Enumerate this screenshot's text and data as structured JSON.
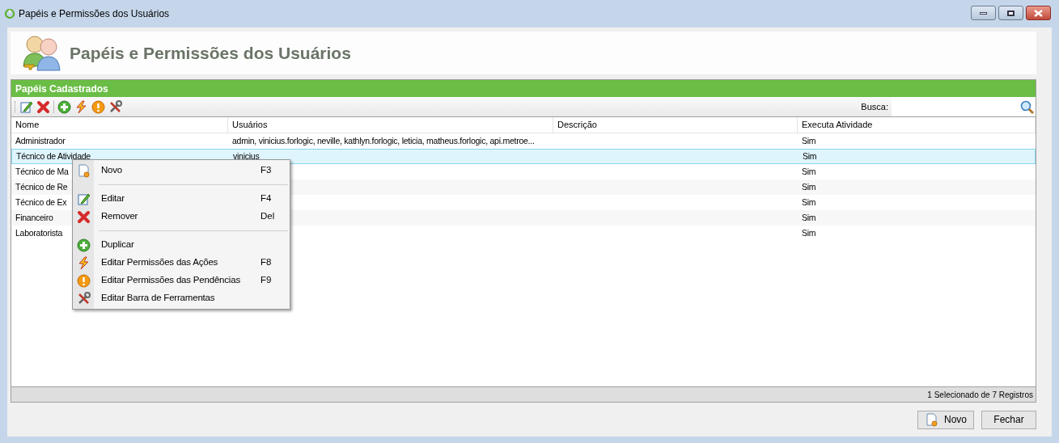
{
  "window": {
    "title": "Papéis e Permissões dos Usuários"
  },
  "header": {
    "title": "Papéis e Permissões dos Usuários"
  },
  "panel": {
    "title": "Papéis Cadastrados"
  },
  "search": {
    "label": "Busca:"
  },
  "table": {
    "columns": [
      "Nome",
      "Usuários",
      "Descrição",
      "Executa Atividade"
    ],
    "rows": [
      {
        "cells": [
          "Administrador",
          "admin, vinicius.forlogic, neville, kathlyn.forlogic, leticia, matheus.forlogic, api.metroe...",
          "",
          "Sim"
        ],
        "selected": false
      },
      {
        "cells": [
          "Técnico de Atividade",
          "vinicius",
          "",
          "Sim"
        ],
        "selected": true
      },
      {
        "cells": [
          "Técnico de Ma",
          "",
          "",
          "Sim"
        ],
        "selected": false
      },
      {
        "cells": [
          "Técnico de Re",
          "",
          "",
          "Sim"
        ],
        "selected": false
      },
      {
        "cells": [
          "Técnico de Ex",
          "",
          "",
          "Sim"
        ],
        "selected": false
      },
      {
        "cells": [
          "Financeiro",
          "",
          "",
          "Sim"
        ],
        "selected": false
      },
      {
        "cells": [
          "Laboratorista",
          "",
          "",
          "Sim"
        ],
        "selected": false
      }
    ]
  },
  "context_menu": {
    "items": [
      {
        "kind": "item",
        "label": "Novo",
        "shortcut": "F3"
      },
      {
        "kind": "separator"
      },
      {
        "kind": "item",
        "label": "Editar",
        "shortcut": "F4"
      },
      {
        "kind": "item",
        "label": "Remover",
        "shortcut": "Del"
      },
      {
        "kind": "separator"
      },
      {
        "kind": "item",
        "label": "Duplicar"
      },
      {
        "kind": "item",
        "label": "Editar Permissões das Ações",
        "shortcut": "F8"
      },
      {
        "kind": "item",
        "label": "Editar Permissões das Pendências",
        "shortcut": "F9"
      },
      {
        "kind": "item",
        "label": "Editar Barra de Ferramentas"
      }
    ]
  },
  "status_bar": {
    "text": "1 Selecionado de 7 Registros"
  },
  "buttons": [
    {
      "label": "Novo",
      "icon": true
    },
    {
      "label": "Fechar",
      "icon": false
    }
  ]
}
